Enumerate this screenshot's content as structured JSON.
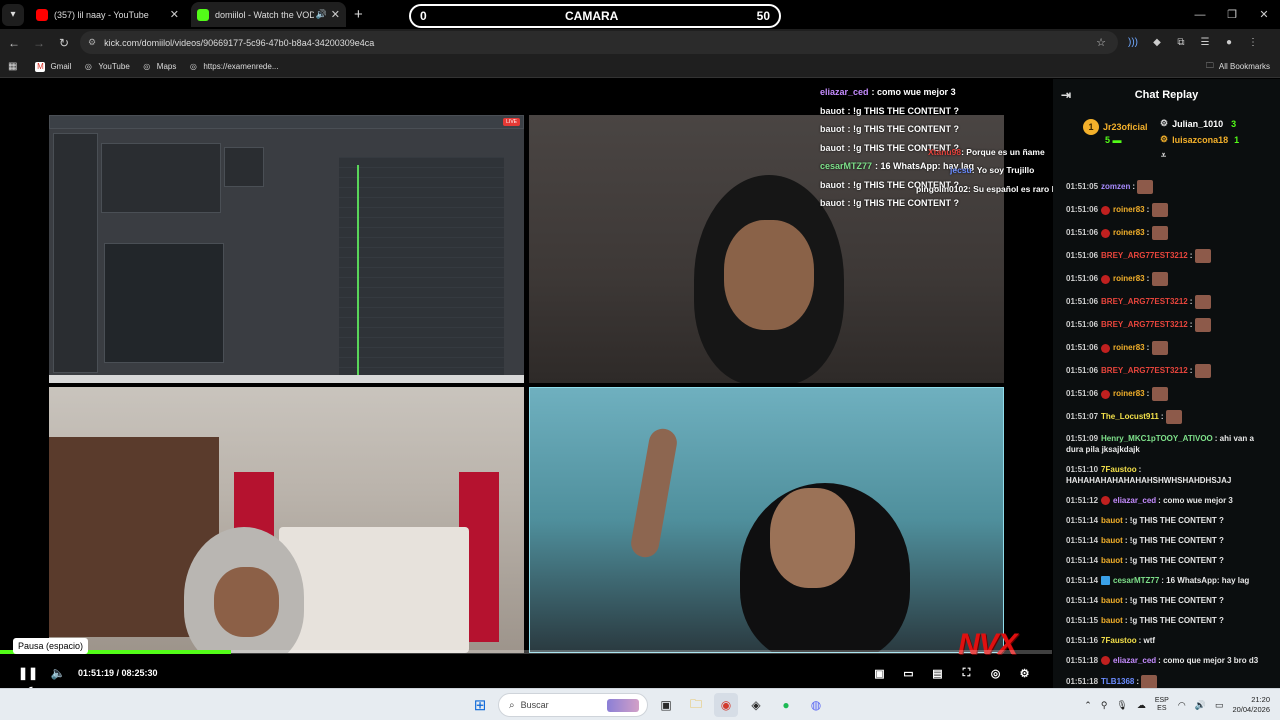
{
  "browser": {
    "tabs": [
      {
        "title": "(357) lil naay - YouTube",
        "favicon_color": "#ff0000",
        "active": false
      },
      {
        "title": "domiilol - Watch the VOD o",
        "favicon_color": "#53fc18",
        "active": true
      }
    ],
    "url": "kick.com/domiilol/videos/90669177-5c96-47b0-b8a4-34200309e4ca",
    "bookmarks": [
      {
        "label": "Gmail",
        "icon": "gmail-icon"
      },
      {
        "label": "YouTube",
        "icon": "youtube-icon"
      },
      {
        "label": "Maps",
        "icon": "maps-icon"
      },
      {
        "label": "https://examenrede...",
        "icon": "globe-icon"
      }
    ],
    "all_bookmarks": "All Bookmarks"
  },
  "camara_bar": {
    "left": "0",
    "title": "CAMARA",
    "right": "50"
  },
  "stream_overlay_chat": [
    {
      "user": "eliazar_ced",
      "text": "como wue mejor 3",
      "color": "#c58cff"
    },
    {
      "user": "bauot",
      "text": "!g THIS THE CONTENT ?",
      "color": "#ffffff"
    },
    {
      "user": "bauot",
      "text": "!g THIS THE CONTENT ?",
      "color": "#ffffff"
    },
    {
      "user": "bauot",
      "text": "!g THIS THE CONTENT ?",
      "color": "#ffffff"
    },
    {
      "user": "cesarMTZ77",
      "text": "16 WhatsApp: hay lag",
      "color": "#7ee08a"
    },
    {
      "user": "bauot",
      "text": "!g THIS THE CONTENT ?",
      "color": "#ffffff"
    },
    {
      "user": "bauot",
      "text": "!g THIS THE CONTENT ?",
      "color": "#ffffff"
    }
  ],
  "stream_overlay_chat2": [
    {
      "user": "Xtanu98",
      "text": "Porque es un ñame",
      "color": "#e0403a"
    },
    {
      "user": "jecsu",
      "text": "Yo soy Trujillo",
      "color": "#6a8cff"
    },
    {
      "user": "pingolin0102",
      "text": "Su español es raro la real",
      "color": "#ffffff"
    }
  ],
  "stream_logo": "NVX",
  "player": {
    "progress": 0.22,
    "tooltip": "Pausa (espacio)",
    "time": "01:51:19 / 08:25:30"
  },
  "chat_replay": {
    "title": "Chat Replay",
    "leaders": [
      {
        "name": "Jr23oficial",
        "count": "5",
        "color": "#f3b02b"
      },
      {
        "name": "Julian_1010",
        "count": "3",
        "color": "#ffffff"
      },
      {
        "name": "luisazcona18",
        "count": "1",
        "color": "#f3b02b"
      }
    ],
    "messages": [
      {
        "ts": "01:51:05",
        "user": "zomzen",
        "color": "#a98cff",
        "text": "",
        "emote": true
      },
      {
        "ts": "01:51:06",
        "user": "roiner83",
        "color": "#f3b02b",
        "text": "",
        "emote": true,
        "badge": "red"
      },
      {
        "ts": "01:51:06",
        "user": "roiner83",
        "color": "#f3b02b",
        "text": "",
        "emote": true,
        "badge": "red"
      },
      {
        "ts": "01:51:06",
        "user": "BREY_ARG77EST3212",
        "color": "#e8453c",
        "text": "",
        "emote": true
      },
      {
        "ts": "01:51:06",
        "user": "roiner83",
        "color": "#f3b02b",
        "text": "",
        "emote": true,
        "badge": "red"
      },
      {
        "ts": "01:51:06",
        "user": "BREY_ARG77EST3212",
        "color": "#e8453c",
        "text": "",
        "emote": true
      },
      {
        "ts": "01:51:06",
        "user": "BREY_ARG77EST3212",
        "color": "#e8453c",
        "text": "",
        "emote": true
      },
      {
        "ts": "01:51:06",
        "user": "roiner83",
        "color": "#f3b02b",
        "text": "",
        "emote": true,
        "badge": "red"
      },
      {
        "ts": "01:51:06",
        "user": "BREY_ARG77EST3212",
        "color": "#e8453c",
        "text": "",
        "emote": true
      },
      {
        "ts": "01:51:06",
        "user": "roiner83",
        "color": "#f3b02b",
        "text": "",
        "emote": true,
        "badge": "red"
      },
      {
        "ts": "01:51:07",
        "user": "The_Locust911",
        "color": "#f3e04a",
        "text": "",
        "emote": true
      },
      {
        "ts": "01:51:09",
        "user": "Henry_MKC1pTOOY_ATIVOO",
        "color": "#7ee08a",
        "text": "ahi van a dura pila jksajkdajk"
      },
      {
        "ts": "01:51:10",
        "user": "7Faustoo",
        "color": "#f3e04a",
        "text": "HAHAHAHAHAHAHAHSHWHSHAHDHSJAJ"
      },
      {
        "ts": "01:51:12",
        "user": "eliazar_ced",
        "color": "#c58cff",
        "text": "como wue mejor 3",
        "badge": "red"
      },
      {
        "ts": "01:51:14",
        "user": "bauot",
        "color": "#f3b02b",
        "text": "!g THIS THE CONTENT ?"
      },
      {
        "ts": "01:51:14",
        "user": "bauot",
        "color": "#f3b02b",
        "text": "!g THIS THE CONTENT ?"
      },
      {
        "ts": "01:51:14",
        "user": "bauot",
        "color": "#f3b02b",
        "text": "!g THIS THE CONTENT ?"
      },
      {
        "ts": "01:51:14",
        "user": "cesarMTZ77",
        "color": "#7ee08a",
        "text": "16 WhatsApp: hay lag",
        "badge": "blue"
      },
      {
        "ts": "01:51:14",
        "user": "bauot",
        "color": "#f3b02b",
        "text": "!g THIS THE CONTENT ?"
      },
      {
        "ts": "01:51:15",
        "user": "bauot",
        "color": "#f3b02b",
        "text": "!g THIS THE CONTENT ?"
      },
      {
        "ts": "01:51:16",
        "user": "7Faustoo",
        "color": "#f3e04a",
        "text": "wtf"
      },
      {
        "ts": "01:51:18",
        "user": "eliazar_ced",
        "color": "#c58cff",
        "text": "como que mejor 3 bro d3",
        "badge": "red"
      },
      {
        "ts": "01:51:18",
        "user": "TLB1368",
        "color": "#6a8cff",
        "text": "",
        "emote": true
      }
    ]
  },
  "taskbar": {
    "search_placeholder": "Buscar",
    "lang_top": "ESP",
    "lang_bottom": "ES",
    "time": "21:20",
    "date": "20/04/2026"
  }
}
